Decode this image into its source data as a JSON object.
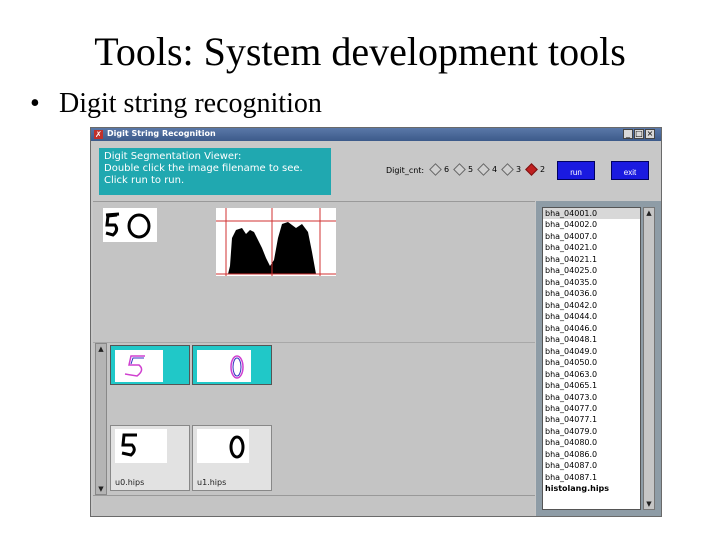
{
  "slide": {
    "title": "Tools: System development tools",
    "bullet": "•",
    "bullet_text": "Digit string recognition"
  },
  "window": {
    "title": "Digit String Recognition",
    "controls": [
      "_",
      "□",
      "×"
    ]
  },
  "info_box": {
    "line1": "Digit Segmentation Viewer:",
    "line2": "Double click the image filename to see.",
    "line3": "Click run to run."
  },
  "digit_count": {
    "label": "Digit_cnt:",
    "options": [
      "6",
      "5",
      "4",
      "3",
      "2"
    ],
    "selected": "2"
  },
  "buttons": {
    "run": "run",
    "exit": "exit"
  },
  "digit_cards": [
    {
      "filename": "u0.hips"
    },
    {
      "filename": "u1.hips"
    }
  ],
  "files": [
    "bha_04001.0",
    "bha_04002.0",
    "bha_04007.0",
    "bha_04021.0",
    "bha_04021.1",
    "bha_04025.0",
    "bha_04035.0",
    "bha_04036.0",
    "bha_04042.0",
    "bha_04044.0",
    "bha_04046.0",
    "bha_04048.1",
    "bha_04049.0",
    "bha_04050.0",
    "bha_04063.0",
    "bha_04065.1",
    "bha_04073.0",
    "bha_04077.0",
    "bha_04077.1",
    "bha_04079.0",
    "bha_04080.0",
    "bha_04086.0",
    "bha_04087.0",
    "bha_04087.1",
    "histolang.hips"
  ],
  "selected_file_index": 0,
  "colors": {
    "info_box": "#20a8b0",
    "button": "#1a1ae0",
    "file_pane": "#8e9ca6",
    "thumb_bg": "#20c8c8"
  }
}
